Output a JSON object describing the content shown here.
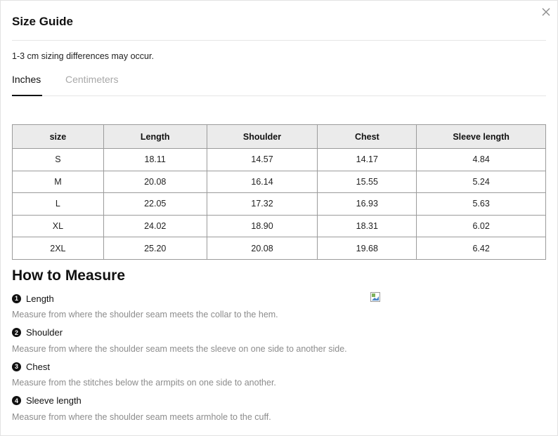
{
  "modal": {
    "title": "Size Guide",
    "note": "1-3 cm sizing differences may occur."
  },
  "tabs": [
    {
      "label": "Inches",
      "active": true
    },
    {
      "label": "Centimeters",
      "active": false
    }
  ],
  "table": {
    "headers": [
      "size",
      "Length",
      "Shoulder",
      "Chest",
      "Sleeve length"
    ],
    "rows": [
      [
        "S",
        "18.11",
        "14.57",
        "14.17",
        "4.84"
      ],
      [
        "M",
        "20.08",
        "16.14",
        "15.55",
        "5.24"
      ],
      [
        "L",
        "22.05",
        "17.32",
        "16.93",
        "5.63"
      ],
      [
        "XL",
        "24.02",
        "18.90",
        "18.31",
        "6.02"
      ],
      [
        "2XL",
        "25.20",
        "20.08",
        "19.68",
        "6.42"
      ]
    ]
  },
  "measure": {
    "title": "How to Measure",
    "items": [
      {
        "number": "1",
        "label": "Length",
        "description": "Measure from where the shoulder seam meets the collar to the hem."
      },
      {
        "number": "2",
        "label": "Shoulder",
        "description": "Measure from where the shoulder seam meets the sleeve on one side to another side."
      },
      {
        "number": "3",
        "label": "Chest",
        "description": "Measure from the stitches below the armpits on one side to another."
      },
      {
        "number": "4",
        "label": "Sleeve length",
        "description": "Measure from where the shoulder seam meets armhole to the cuff."
      }
    ]
  },
  "icons": {
    "close": "close-icon",
    "image_placeholder": "broken-image-icon"
  },
  "colors": {
    "header_bg": "#ebebeb",
    "border": "#9b9b9b",
    "muted_text": "#8c8c8c",
    "inactive_tab": "#a8a8a8"
  }
}
